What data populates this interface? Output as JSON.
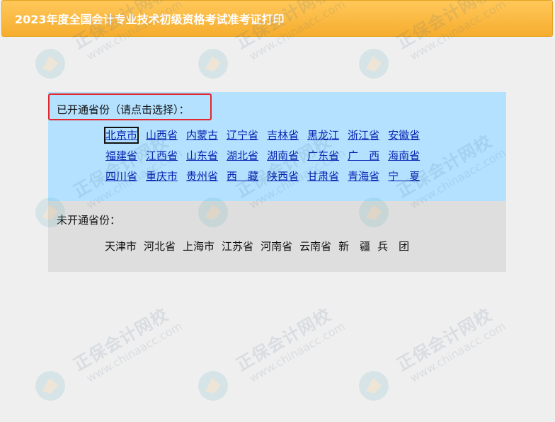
{
  "header": {
    "title": "2023年度全国会计专业技术初级资格考试准考证打印"
  },
  "open_section": {
    "label": "已开通省份（请点击选择）：",
    "rows": [
      [
        "北京市",
        "山西省",
        "内蒙古",
        "辽宁省",
        "吉林省",
        "黑龙江",
        "浙江省",
        "安徽省"
      ],
      [
        "福建省",
        "江西省",
        "山东省",
        "湖北省",
        "湖南省",
        "广东省",
        "广　西",
        "海南省"
      ],
      [
        "四川省",
        "重庆市",
        "贵州省",
        "西　藏",
        "陕西省",
        "甘肃省",
        "青海省",
        "宁　夏"
      ]
    ],
    "selected": "北京市"
  },
  "closed_section": {
    "label": "未开通省份：",
    "items": [
      "天津市",
      "河北省",
      "上海市",
      "江苏省",
      "河南省",
      "云南省",
      "新　疆",
      "兵　团"
    ]
  },
  "watermark": {
    "brand": "正保会计网校",
    "url": "www.chinaacc.com"
  },
  "colors": {
    "header_bg": "#f6ad2e",
    "open_panel_bg": "#b3e1ff",
    "closed_panel_bg": "#dedede",
    "link": "#0a22b0",
    "highlight_border": "#e4272a"
  }
}
